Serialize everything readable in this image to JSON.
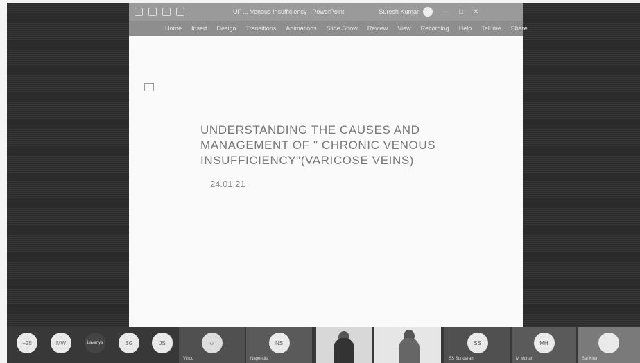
{
  "titlebar": {
    "doc_title": "UF ... Venous Insufficiency",
    "app_name": "PowerPoint",
    "account": "Suresh Kumar",
    "window_controls": [
      "—",
      "□",
      "✕"
    ]
  },
  "ribbon": {
    "tabs": [
      "Home",
      "Insert",
      "Design",
      "Transitions",
      "Animations",
      "Slide Show",
      "Review",
      "View",
      "Recording",
      "Help"
    ],
    "tell_me": "Tell me",
    "share": "Share"
  },
  "slide": {
    "title_lines": [
      "UNDERSTANDING THE CAUSES AND",
      "MANAGEMENT OF \" CHRONIC VENOUS",
      "INSUFFICIENCY\"(VARICOSE VEINS)"
    ],
    "date": "24.01.21"
  },
  "participants": {
    "overflow": "+25",
    "circles": [
      "MW",
      "Lavanya",
      "SG",
      "",
      "JS"
    ],
    "tiles": [
      {
        "initials": "",
        "name": "Vinod"
      },
      {
        "initials": "NS",
        "name": "Nagendra"
      },
      {
        "initials": "SS",
        "name": "SS Sundaram"
      },
      {
        "initials": "MH",
        "name": "M Mohan"
      },
      {
        "initials": "",
        "name": "Sai Kiran"
      }
    ]
  }
}
